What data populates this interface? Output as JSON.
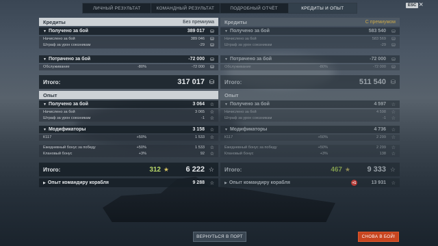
{
  "tabs": [
    "ЛИЧНЫЙ РЕЗУЛЬТАТ",
    "КОМАНДНЫЙ РЕЗУЛЬТАТ",
    "ПОДРОБНЫЙ ОТЧЁТ",
    "КРЕДИТЫ И ОПЫТ"
  ],
  "esc_label": "ESC",
  "left": {
    "credits_header": "Кредиты",
    "credits_mode": "Без премиума",
    "earned_label": "Получено за бой",
    "earned_value": "389 017",
    "accrued_label": "Начислено за бой",
    "accrued_value": "389 046",
    "penalty_label": "Штраф за урон союзникам",
    "penalty_value": "-29",
    "spent_label": "Потрачено за бой",
    "spent_value": "-72 000",
    "service_label": "Обслуживание",
    "service_pct": "-80%",
    "service_value": "-72 000",
    "credits_total_label": "Итого:",
    "credits_total_value": "317 017",
    "xp_header": "Опыт",
    "xp_earned_label": "Получено за бой",
    "xp_earned_value": "3 064",
    "xp_accrued_label": "Начислено за бой",
    "xp_accrued_value": "3 065",
    "xp_penalty_label": "Штраф за урон союзникам",
    "xp_penalty_value": "-1",
    "mods_label": "Модификаторы",
    "mods_value": "3 158",
    "mod1_label": "К117",
    "mod1_pct": "+50%",
    "mod1_value": "1 533",
    "mod2_label": "Ежедневный бонус за победу",
    "mod2_pct": "+50%",
    "mod2_value": "1 533",
    "mod3_label": "Клановый бонус",
    "mod3_pct": "+3%",
    "mod3_value": "92",
    "xp_total_label": "Итого:",
    "xp_total_free": "312",
    "xp_total_value": "6 222",
    "cmd_label": "Опыт командиру корабля",
    "cmd_value": "9 288"
  },
  "right": {
    "credits_header": "Кредиты",
    "credits_mode": "С премиумом",
    "earned_label": "Получено за бой",
    "earned_value": "583 540",
    "accrued_label": "Начислено за бой",
    "accrued_value": "583 569",
    "penalty_label": "Штраф за урон союзникам",
    "penalty_value": "-29",
    "spent_label": "Потрачено за бой",
    "spent_value": "-72 000",
    "service_label": "Обслуживание",
    "service_pct": "-80%",
    "service_value": "-72 000",
    "credits_total_label": "Итого:",
    "credits_total_value": "511 540",
    "xp_header": "Опыт",
    "xp_earned_label": "Получено за бой",
    "xp_earned_value": "4 597",
    "xp_accrued_label": "Начислено за бой",
    "xp_accrued_value": "4 598",
    "xp_penalty_label": "Штраф за урон союзникам",
    "xp_penalty_value": "-1",
    "mods_label": "Модификаторы",
    "mods_value": "4 736",
    "mod1_label": "К117",
    "mod1_pct": "+50%",
    "mod1_value": "2 299",
    "mod2_label": "Ежедневный бонус за победу",
    "mod2_pct": "+50%",
    "mod2_value": "2 299",
    "mod3_label": "Клановый бонус",
    "mod3_pct": "+3%",
    "mod3_value": "138",
    "xp_total_label": "Итого:",
    "xp_total_free": "467",
    "xp_total_value": "9 333",
    "cmd_label": "Опыт командиру корабля",
    "cmd_badge": "+1",
    "cmd_value": "13 931"
  },
  "buttons": {
    "port": "ВЕРНУТЬСЯ В ПОРТ",
    "battle": "СНОВА В БОЙ!"
  }
}
